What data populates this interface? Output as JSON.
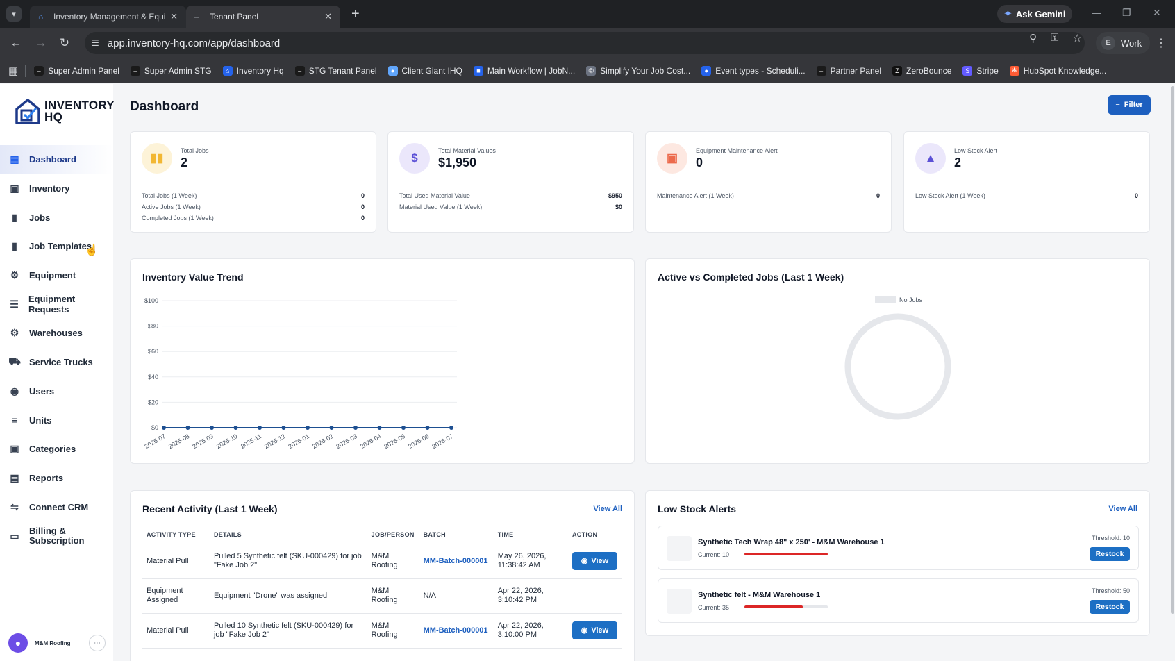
{
  "browser": {
    "tabs": [
      {
        "label": "Inventory Management & Equipm"
      },
      {
        "label": "Tenant Panel"
      }
    ],
    "ask_gemini": "Ask Gemini",
    "url": "app.inventory-hq.com/app/dashboard",
    "profile_initial": "E",
    "profile_label": "Work",
    "bookmarks": [
      {
        "label": "Super Admin Panel",
        "icon": "dash-icon",
        "color": "#1a1a1a"
      },
      {
        "label": "Super Admin STG",
        "icon": "dash-icon",
        "color": "#1a1a1a"
      },
      {
        "label": "Inventory Hq",
        "icon": "house-icon",
        "color": "#2563eb"
      },
      {
        "label": "STG Tenant Panel",
        "icon": "dash-icon",
        "color": "#1a1a1a"
      },
      {
        "label": "Client Giant IHQ",
        "icon": "circle-icon",
        "color": "#60a5fa"
      },
      {
        "label": "Main Workflow | JobN...",
        "icon": "square-icon",
        "color": "#2563eb"
      },
      {
        "label": "Simplify Your Job Cost...",
        "icon": "globe-icon",
        "color": "#6b7280"
      },
      {
        "label": "Event types - Scheduli...",
        "icon": "circle-icon",
        "color": "#2563eb"
      },
      {
        "label": "Partner Panel",
        "icon": "dash-icon",
        "color": "#1a1a1a"
      },
      {
        "label": "ZeroBounce",
        "icon": "zb-icon",
        "color": "#111111"
      },
      {
        "label": "Stripe",
        "icon": "stripe-icon",
        "color": "#635bff"
      },
      {
        "label": "HubSpot Knowledge...",
        "icon": "hubspot-icon",
        "color": "#ff5c35"
      }
    ]
  },
  "sidebar": {
    "logo_line1": "INVENTORY",
    "logo_line2": "HQ",
    "items": [
      {
        "label": "Dashboard",
        "icon": "grid-icon"
      },
      {
        "label": "Inventory",
        "icon": "boxes-icon"
      },
      {
        "label": "Jobs",
        "icon": "briefcase-icon"
      },
      {
        "label": "Job Templates",
        "icon": "briefcase-icon"
      },
      {
        "label": "Equipment",
        "icon": "gear-search-icon"
      },
      {
        "label": "Equipment Requests",
        "icon": "list-icon"
      },
      {
        "label": "Warehouses",
        "icon": "gear-search-icon"
      },
      {
        "label": "Service Trucks",
        "icon": "truck-icon"
      },
      {
        "label": "Users",
        "icon": "users-icon"
      },
      {
        "label": "Units",
        "icon": "units-icon"
      },
      {
        "label": "Categories",
        "icon": "boxes-icon"
      },
      {
        "label": "Reports",
        "icon": "chart-icon"
      },
      {
        "label": "Connect CRM",
        "icon": "connect-icon"
      },
      {
        "label": "Billing & Subscription",
        "icon": "card-icon"
      }
    ],
    "user_name": "M&M Roofing"
  },
  "header": {
    "title": "Dashboard",
    "filter_label": "Filter"
  },
  "stats": [
    {
      "title": "Total Jobs",
      "value": "2",
      "rows": [
        {
          "label": "Total Jobs (1 Week)",
          "value": "0"
        },
        {
          "label": "Active Jobs (1 Week)",
          "value": "0"
        },
        {
          "label": "Completed Jobs (1 Week)",
          "value": "0"
        }
      ]
    },
    {
      "title": "Total Material Values",
      "value": "$1,950",
      "rows": [
        {
          "label": "Total Used Material Value",
          "value": "$950"
        },
        {
          "label": "Material Used Value (1 Week)",
          "value": "$0"
        }
      ]
    },
    {
      "title": "Equipment Maintenance Alert",
      "value": "0",
      "rows": [
        {
          "label": "Maintenance Alert (1 Week)",
          "value": "0"
        }
      ]
    },
    {
      "title": "Low Stock Alert",
      "value": "2",
      "rows": [
        {
          "label": "Low Stock Alert (1 Week)",
          "value": "0"
        }
      ]
    }
  ],
  "chart_data": [
    {
      "type": "line",
      "title": "Inventory Value Trend",
      "x": [
        "2025-07",
        "2025-08",
        "2025-09",
        "2025-10",
        "2025-11",
        "2025-12",
        "2026-01",
        "2026-02",
        "2026-03",
        "2026-04",
        "2026-05",
        "2026-06",
        "2026-07"
      ],
      "y_ticks": [
        "$100",
        "$80",
        "$60",
        "$40",
        "$20",
        "$0"
      ],
      "values": [
        0,
        0,
        0,
        0,
        0,
        0,
        0,
        0,
        0,
        0,
        0,
        0,
        0
      ],
      "ylim": [
        0,
        100
      ],
      "color": "#1d4f91",
      "grid": true
    },
    {
      "type": "pie",
      "title": "Active vs Completed Jobs (Last 1 Week)",
      "legend": [
        "No Jobs"
      ],
      "values": [
        1
      ],
      "color": "#e5e7eb"
    }
  ],
  "activity": {
    "title": "Recent Activity (Last 1 Week)",
    "view_all": "View All",
    "columns": [
      "ACTIVITY TYPE",
      "DETAILS",
      "JOB/PERSON",
      "BATCH",
      "TIME",
      "ACTION"
    ],
    "rows": [
      {
        "type": "Material Pull",
        "details": "Pulled 5 Synthetic felt (SKU-000429) for job \"Fake Job 2\"",
        "person": "M&M Roofing",
        "batch": "MM-Batch-000001",
        "time": "May 26, 2026, 11:38:42 AM",
        "action": "View"
      },
      {
        "type": "Equipment Assigned",
        "details": "Equipment \"Drone\" was assigned",
        "person": "M&M Roofing",
        "batch": "N/A",
        "time": "Apr 22, 2026, 3:10:42 PM",
        "action": ""
      },
      {
        "type": "Material Pull",
        "details": "Pulled 10 Synthetic felt (SKU-000429) for job \"Fake Job 2\"",
        "person": "M&M Roofing",
        "batch": "MM-Batch-000001",
        "time": "Apr 22, 2026, 3:10:00 PM",
        "action": "View"
      }
    ]
  },
  "low_stock": {
    "title": "Low Stock Alerts",
    "view_all": "View All",
    "items": [
      {
        "name": "Synthetic Tech Wrap 48\" x 250' - M&M Warehouse 1",
        "current": "Current: 10",
        "threshold": "Threshold: 10",
        "level": 1.0,
        "action": "Restock"
      },
      {
        "name": "Synthetic felt - M&M Warehouse 1",
        "current": "Current: 35",
        "threshold": "Threshold: 50",
        "level": 0.7,
        "action": "Restock"
      }
    ]
  }
}
